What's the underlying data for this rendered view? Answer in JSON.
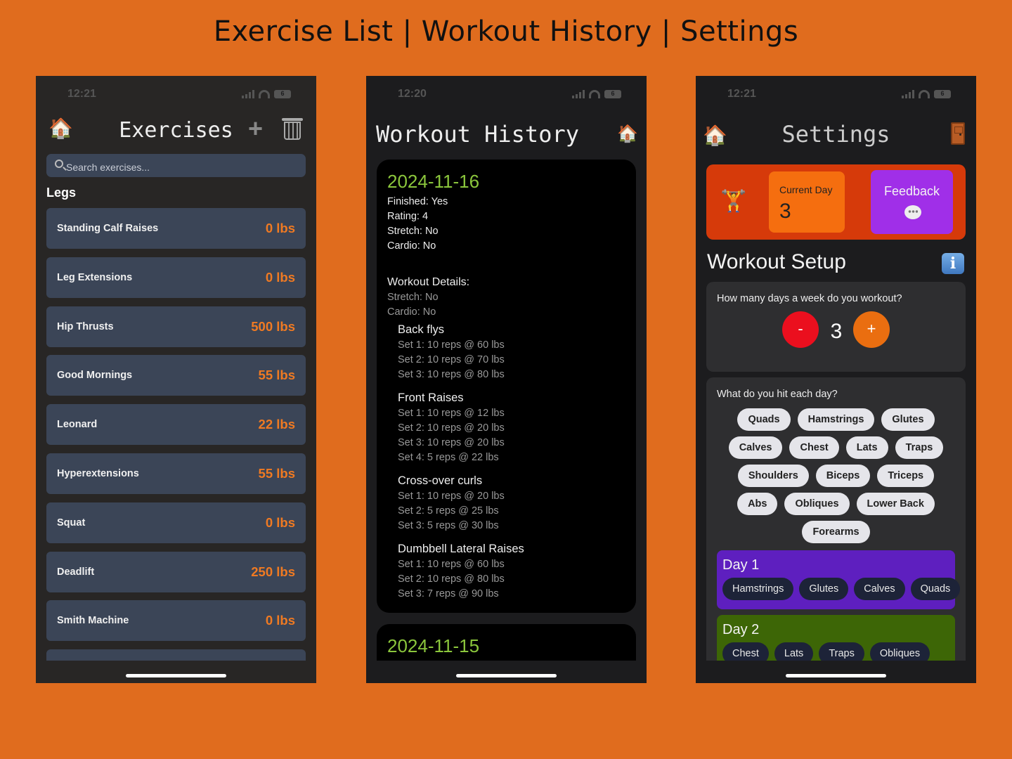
{
  "page_title": "Exercise List | Workout History | Settings",
  "colors": {
    "background": "#E06C1E",
    "accent_orange": "#F07A22",
    "date_green": "#8BC63C",
    "row_blue": "#3B4557",
    "purple": "#A02FE8",
    "red": "#EB0F1E"
  },
  "exercise_screen": {
    "status_time": "12:21",
    "battery": "6",
    "title": "Exercises",
    "icons": {
      "home": "house-icon",
      "add": "plus-icon",
      "delete": "trash-icon",
      "search": "search-icon"
    },
    "search_placeholder": "Search exercises...",
    "section": "Legs",
    "exercises": [
      {
        "name": "Standing Calf Raises",
        "weight": "0 lbs"
      },
      {
        "name": "Leg Extensions",
        "weight": "0 lbs"
      },
      {
        "name": "Hip Thrusts",
        "weight": "500 lbs"
      },
      {
        "name": "Good Mornings",
        "weight": "55 lbs"
      },
      {
        "name": "Leonard",
        "weight": "22 lbs"
      },
      {
        "name": "Hyperextensions",
        "weight": "55 lbs"
      },
      {
        "name": "Squat",
        "weight": "0 lbs"
      },
      {
        "name": "Deadlift",
        "weight": "250 lbs"
      },
      {
        "name": "Smith Machine",
        "weight": "0 lbs"
      }
    ]
  },
  "history_screen": {
    "status_time": "12:20",
    "battery": "6",
    "title": "Workout History",
    "entries": [
      {
        "date": "2024-11-16",
        "finished": "Finished: Yes",
        "rating": "Rating: 4",
        "stretch": "Stretch: No",
        "cardio": "Cardio: No",
        "details_label": "Workout Details:",
        "details_stretch": "Stretch: No",
        "details_cardio": "Cardio: No",
        "exercises": [
          {
            "name": "Back flys",
            "sets": [
              "Set 1: 10 reps @ 60 lbs",
              "Set 2: 10 reps @ 70 lbs",
              "Set 3: 10 reps @ 80 lbs"
            ]
          },
          {
            "name": "Front Raises",
            "sets": [
              "Set 1: 10 reps @ 12 lbs",
              "Set 2: 10 reps @ 20 lbs",
              "Set 3: 10 reps @ 20 lbs",
              "Set 4: 5 reps @ 22 lbs"
            ]
          },
          {
            "name": "Cross-over curls",
            "sets": [
              "Set 1: 10 reps @ 20 lbs",
              "Set 2: 5 reps @ 25 lbs",
              "Set 3: 5 reps @ 30 lbs"
            ]
          },
          {
            "name": "Dumbbell Lateral Raises",
            "sets": [
              "Set 1: 10 reps @ 60 lbs",
              "Set 2: 10 reps @ 80 lbs",
              "Set 3: 7 reps @ 90 lbs"
            ]
          }
        ]
      },
      {
        "date": "2024-11-15"
      }
    ]
  },
  "settings_screen": {
    "status_time": "12:21",
    "battery": "6",
    "title": "Settings",
    "current_day_label": "Current Day",
    "current_day_value": "3",
    "feedback_label": "Feedback",
    "setup_title": "Workout Setup",
    "info_label": "i",
    "days_question": "How many days a week do you workout?",
    "minus_label": "-",
    "plus_label": "+",
    "days_value": "3",
    "hit_question": "What do you hit each day?",
    "muscle_rows": [
      [
        "Quads",
        "Hamstrings",
        "Glutes"
      ],
      [
        "Calves",
        "Chest",
        "Lats",
        "Traps"
      ],
      [
        "Shoulders",
        "Biceps",
        "Triceps"
      ],
      [
        "Abs",
        "Obliques",
        "Lower Back"
      ],
      [
        "Forearms"
      ]
    ],
    "days": [
      {
        "title": "Day 1",
        "muscles": [
          "Hamstrings",
          "Glutes",
          "Calves",
          "Quads"
        ]
      },
      {
        "title": "Day 2",
        "muscles": [
          "Chest",
          "Lats",
          "Traps",
          "Obliques"
        ]
      }
    ]
  }
}
